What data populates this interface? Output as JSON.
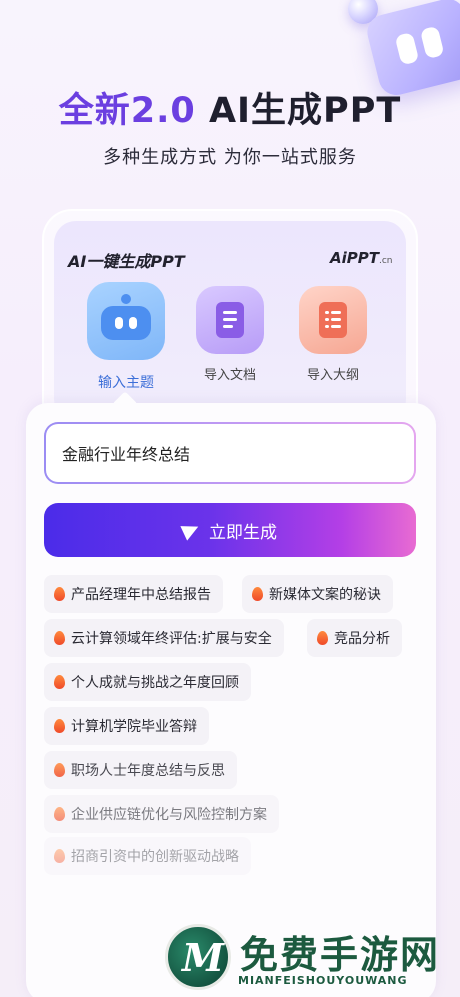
{
  "hero": {
    "title_accent": "全新2.0",
    "title_rest": " AI生成PPT",
    "subtitle": "多种生成方式 为你一站式服务"
  },
  "card": {
    "title": "AI一键生成PPT",
    "logo": "AiPPT",
    "logo_suffix": ".cn",
    "modes": [
      {
        "label": "输入主题",
        "icon": "robot-icon",
        "active": true
      },
      {
        "label": "导入文档",
        "icon": "document-icon",
        "active": false
      },
      {
        "label": "导入大纲",
        "icon": "outline-icon",
        "active": false
      }
    ]
  },
  "input": {
    "value": "金融行业年终总结"
  },
  "generate_button": {
    "label": "立即生成",
    "icon": "send-icon",
    "gradient": [
      "#4b2ce9",
      "#b43fe6",
      "#e86bd2"
    ]
  },
  "suggestions": [
    "产品经理年中总结报告",
    "新媒体文案的秘诀",
    "云计算领域年终评估:扩展与安全",
    "竞品分析",
    "个人成就与挑战之年度回顾",
    "计算机学院毕业答辩",
    "职场人士年度总结与反思",
    "企业供应链优化与风险控制方案",
    "招商引资中的创新驱动战略"
  ],
  "watermark": {
    "mark": "M",
    "text": "免费手游网",
    "sub": "MIANFEISHOUYOUWANG"
  },
  "colors": {
    "accent_purple": "#6b3fe0",
    "active_blue": "#3c6fd8",
    "flame": "#ef4a2a"
  }
}
